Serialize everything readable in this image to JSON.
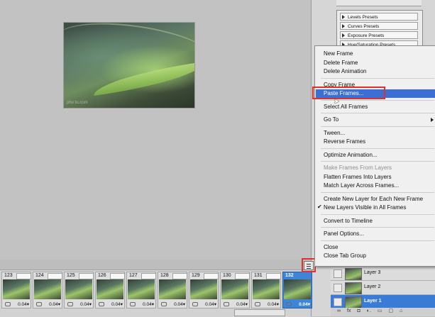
{
  "canvas": {
    "watermark": "pho tu.com"
  },
  "adjustments": {
    "presets": [
      "Levels Presets",
      "Curves Presets",
      "Exposure Presets",
      "Hue/Saturation Presets"
    ]
  },
  "context_menu": {
    "items": [
      {
        "label": "New Frame",
        "state": "normal"
      },
      {
        "label": "Delete Frame",
        "state": "normal"
      },
      {
        "label": "Delete Animation",
        "state": "normal"
      },
      {
        "sep": true
      },
      {
        "label": "Copy Frame",
        "state": "normal"
      },
      {
        "label": "Paste Frames...",
        "state": "highlighted"
      },
      {
        "sep": true
      },
      {
        "label": "Select All Frames",
        "state": "normal"
      },
      {
        "sep": true
      },
      {
        "label": "Go To",
        "state": "normal",
        "submenu": true
      },
      {
        "sep": true
      },
      {
        "label": "Tween...",
        "state": "normal"
      },
      {
        "label": "Reverse Frames",
        "state": "normal"
      },
      {
        "sep": true
      },
      {
        "label": "Optimize Animation...",
        "state": "normal"
      },
      {
        "sep": true
      },
      {
        "label": "Make Frames From Layers",
        "state": "disabled"
      },
      {
        "label": "Flatten Frames Into Layers",
        "state": "normal"
      },
      {
        "label": "Match Layer Across Frames...",
        "state": "normal"
      },
      {
        "sep": true
      },
      {
        "label": "Create New Layer for Each New Frame",
        "state": "normal"
      },
      {
        "label": "New Layers Visible in All Frames",
        "state": "normal",
        "checked": true
      },
      {
        "sep": true
      },
      {
        "label": "Convert to Timeline",
        "state": "normal"
      },
      {
        "sep": true
      },
      {
        "label": "Panel Options...",
        "state": "normal"
      },
      {
        "sep": true
      },
      {
        "label": "Close",
        "state": "normal"
      },
      {
        "label": "Close Tab Group",
        "state": "normal"
      }
    ],
    "check_mark": "✔"
  },
  "layers": [
    {
      "name": "Layer 3",
      "selected": false
    },
    {
      "name": "Layer 2",
      "selected": false
    },
    {
      "name": "Layer 1",
      "selected": true
    }
  ],
  "layers_footer_icons": [
    "link-icon",
    "fx-icon",
    "mask-icon",
    "adjustment-icon",
    "group-icon",
    "new-layer-icon",
    "trash-icon"
  ],
  "layers_footer_glyphs": [
    "∞",
    "fx",
    "◘",
    "◐.",
    "▭",
    "▢",
    "⌂"
  ],
  "animation": {
    "frames": [
      {
        "number": "123",
        "delay": "0.04▾",
        "selected": false
      },
      {
        "number": "124",
        "delay": "0.04▾",
        "selected": false
      },
      {
        "number": "125",
        "delay": "0.04▾",
        "selected": false
      },
      {
        "number": "126",
        "delay": "0.04▾",
        "selected": false
      },
      {
        "number": "127",
        "delay": "0.04▾",
        "selected": false
      },
      {
        "number": "128",
        "delay": "0.04▾",
        "selected": false
      },
      {
        "number": "129",
        "delay": "0.04▾",
        "selected": false
      },
      {
        "number": "130",
        "delay": "0.04▾",
        "selected": false
      },
      {
        "number": "131",
        "delay": "0.04▾",
        "selected": false
      },
      {
        "number": "132",
        "delay": "0.04▾",
        "selected": true
      }
    ]
  },
  "colors": {
    "highlight": "#3c6fd4",
    "annotation_red": "#e0302a",
    "selected_layer": "#3a7bd5"
  }
}
